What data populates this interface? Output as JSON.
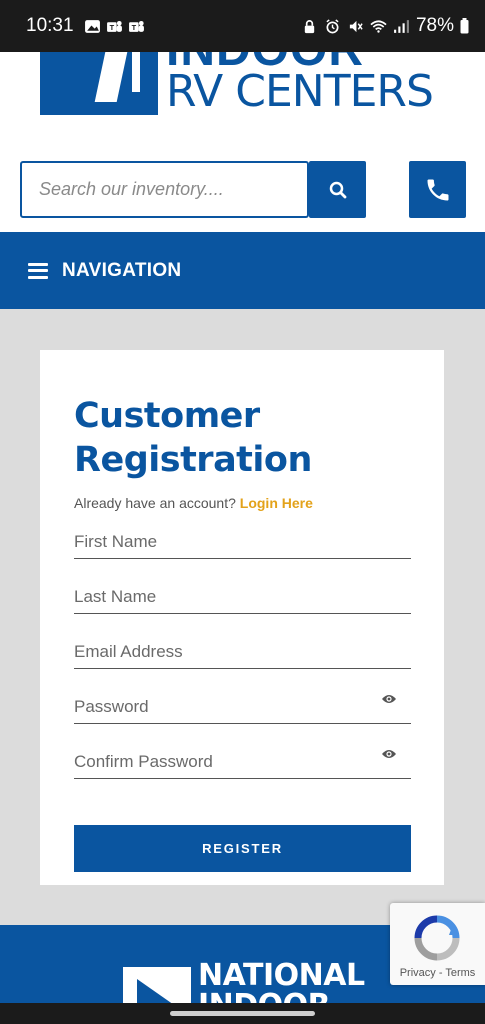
{
  "status_bar": {
    "time": "10:31",
    "battery": "78%"
  },
  "header": {
    "logo_top": "INDOOR",
    "logo_text": "RV CENTERS",
    "search_placeholder": "Search our inventory....",
    "search_icon": "search-icon",
    "phone_icon": "phone-icon"
  },
  "nav": {
    "label": "NAVIGATION",
    "icon": "hamburger-menu-icon"
  },
  "form": {
    "title": "Customer Registration",
    "already_text": "Already have an account?",
    "login_link": "Login Here",
    "first_name_placeholder": "First Name",
    "last_name_placeholder": "Last Name",
    "email_placeholder": "Email Address",
    "password_placeholder": "Password",
    "confirm_password_placeholder": "Confirm Password",
    "register_label": "REGISTER"
  },
  "footer": {
    "logo_line1": "NATIONAL",
    "logo_line2": "INDOOR"
  },
  "recaptcha": {
    "privacy": "Privacy",
    "separator": " - ",
    "terms": "Terms"
  },
  "colors": {
    "brand_blue": "#0a55a0",
    "link_gold": "#e3a21a",
    "page_bg": "#dcdcdc"
  }
}
